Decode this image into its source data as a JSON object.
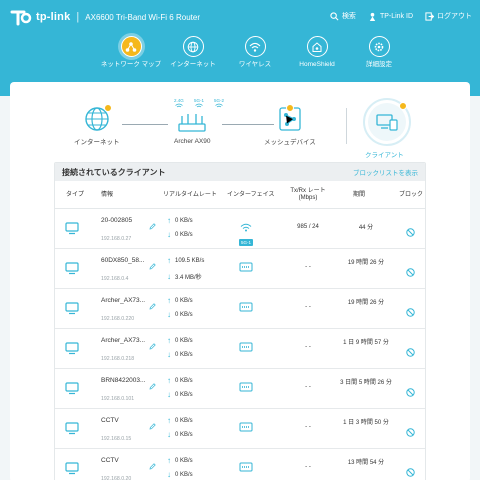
{
  "brand": {
    "logo": "tp-link",
    "model": "AX6600 Tri-Band Wi-Fi 6 Router"
  },
  "top_actions": [
    {
      "label": "検索",
      "icon": "search-icon"
    },
    {
      "label": "TP-Link ID",
      "icon": "id-icon"
    },
    {
      "label": "ログアウト",
      "icon": "logout-icon"
    }
  ],
  "nav": [
    {
      "label": "ネットワーク マップ",
      "icon": "network-map-icon",
      "active": true
    },
    {
      "label": "インターネット",
      "icon": "globe-icon"
    },
    {
      "label": "ワイヤレス",
      "icon": "wifi-icon"
    },
    {
      "label": "HomeShield",
      "icon": "home-shield-icon"
    },
    {
      "label": "詳細設定",
      "icon": "gear-icon"
    }
  ],
  "topology": {
    "internet": "インターネット",
    "router": "Archer AX90",
    "mesh": "メッシュデバイス",
    "clients": "クライアント",
    "bands": [
      "2.4G",
      "5G-1",
      "5G-2"
    ]
  },
  "clients_card": {
    "title": "接続されているクライアント",
    "blocklist_link": "ブロックリストを表示",
    "columns": {
      "type": "タイプ",
      "info": "情報",
      "realtime": "リアルタイムレート",
      "interface": "インターフェイス",
      "txrx": "Tx/Rx レート (Mbps)",
      "duration": "期間",
      "block": "ブロック"
    },
    "rows": [
      {
        "name": "20-002805",
        "ip": "192.168.0.27",
        "up": "0 KB/s",
        "down": "0 KB/s",
        "iface": "wifi",
        "band": "5G-1",
        "txrx": "985 / 24",
        "duration": "44 分"
      },
      {
        "name": "60DX850_58...",
        "ip": "192.168.0.4",
        "up": "109.5 KB/s",
        "down": "3.4 MB/秒",
        "iface": "lan",
        "txrx": "- -",
        "duration": "19 時間 26 分"
      },
      {
        "name": "Archer_AX73...",
        "ip": "192.168.0.220",
        "up": "0 KB/s",
        "down": "0 KB/s",
        "iface": "lan",
        "txrx": "- -",
        "duration": "19 時間 26 分"
      },
      {
        "name": "Archer_AX73...",
        "ip": "192.168.0.218",
        "up": "0 KB/s",
        "down": "0 KB/s",
        "iface": "lan",
        "txrx": "- -",
        "duration": "1 日 9 時間 57 分"
      },
      {
        "name": "BRN8422003...",
        "ip": "192.168.0.101",
        "up": "0 KB/s",
        "down": "0 KB/s",
        "iface": "lan",
        "txrx": "- -",
        "duration": "3 日間 5 時間 26 分"
      },
      {
        "name": "CCTV",
        "ip": "192.168.0.15",
        "up": "0 KB/s",
        "down": "0 KB/s",
        "iface": "lan",
        "txrx": "- -",
        "duration": "1 日 3 時間 50 分"
      },
      {
        "name": "CCTV",
        "ip": "192.168.0.20",
        "up": "0 KB/s",
        "down": "0 KB/s",
        "iface": "lan",
        "txrx": "- -",
        "duration": "13 時間 54 分"
      }
    ]
  },
  "colors": {
    "accent": "#35b6d6",
    "active": "#f5b81c"
  }
}
